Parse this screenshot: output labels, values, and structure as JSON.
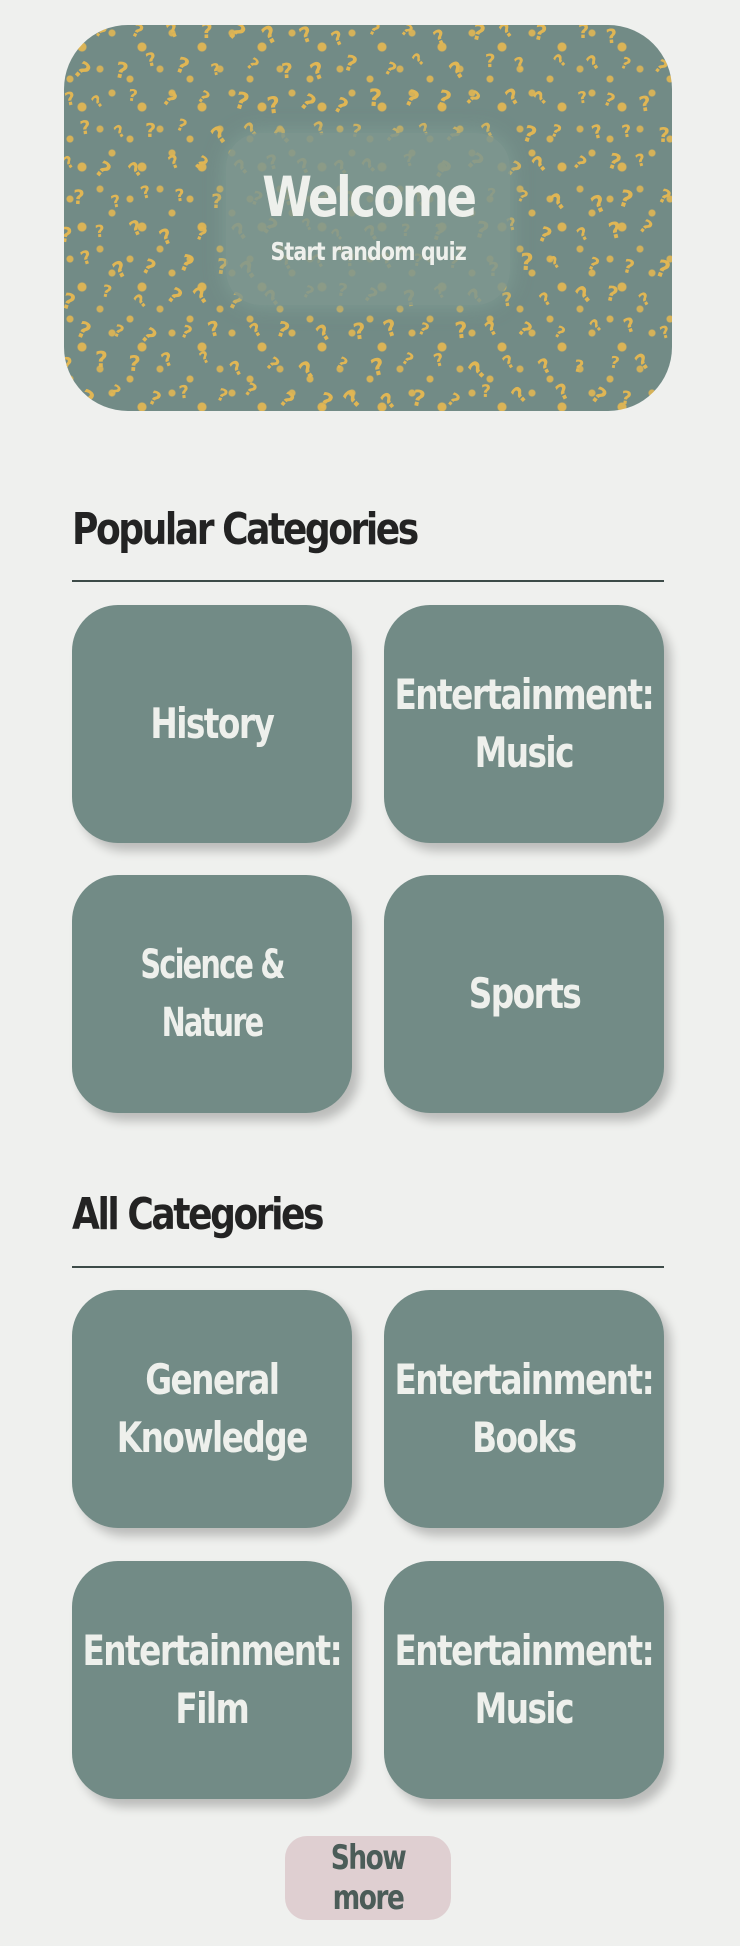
{
  "hero": {
    "title": "Welcome",
    "subtitle": "Start random quiz",
    "background_color": "#728b86",
    "pattern_color": "#e0b654",
    "pattern_icon": "question-mark-pattern"
  },
  "popular": {
    "heading": "Popular Categories",
    "items": [
      {
        "label": "History"
      },
      {
        "label": "Entertainment:\nMusic"
      },
      {
        "label": "Science & Nature"
      },
      {
        "label": "Sports"
      }
    ]
  },
  "all": {
    "heading": "All Categories",
    "items": [
      {
        "label": "General\nKnowledge"
      },
      {
        "label": "Entertainment:\nBooks"
      },
      {
        "label": "Entertainment:\nFilm"
      },
      {
        "label": "Entertainment:\nMusic"
      }
    ]
  },
  "show_more": {
    "label": "Show more",
    "color": "#dfcfd1"
  },
  "colors": {
    "background": "#eff0ee",
    "card": "#728b86",
    "card_text": "#eef0ec",
    "heading": "#232323"
  }
}
